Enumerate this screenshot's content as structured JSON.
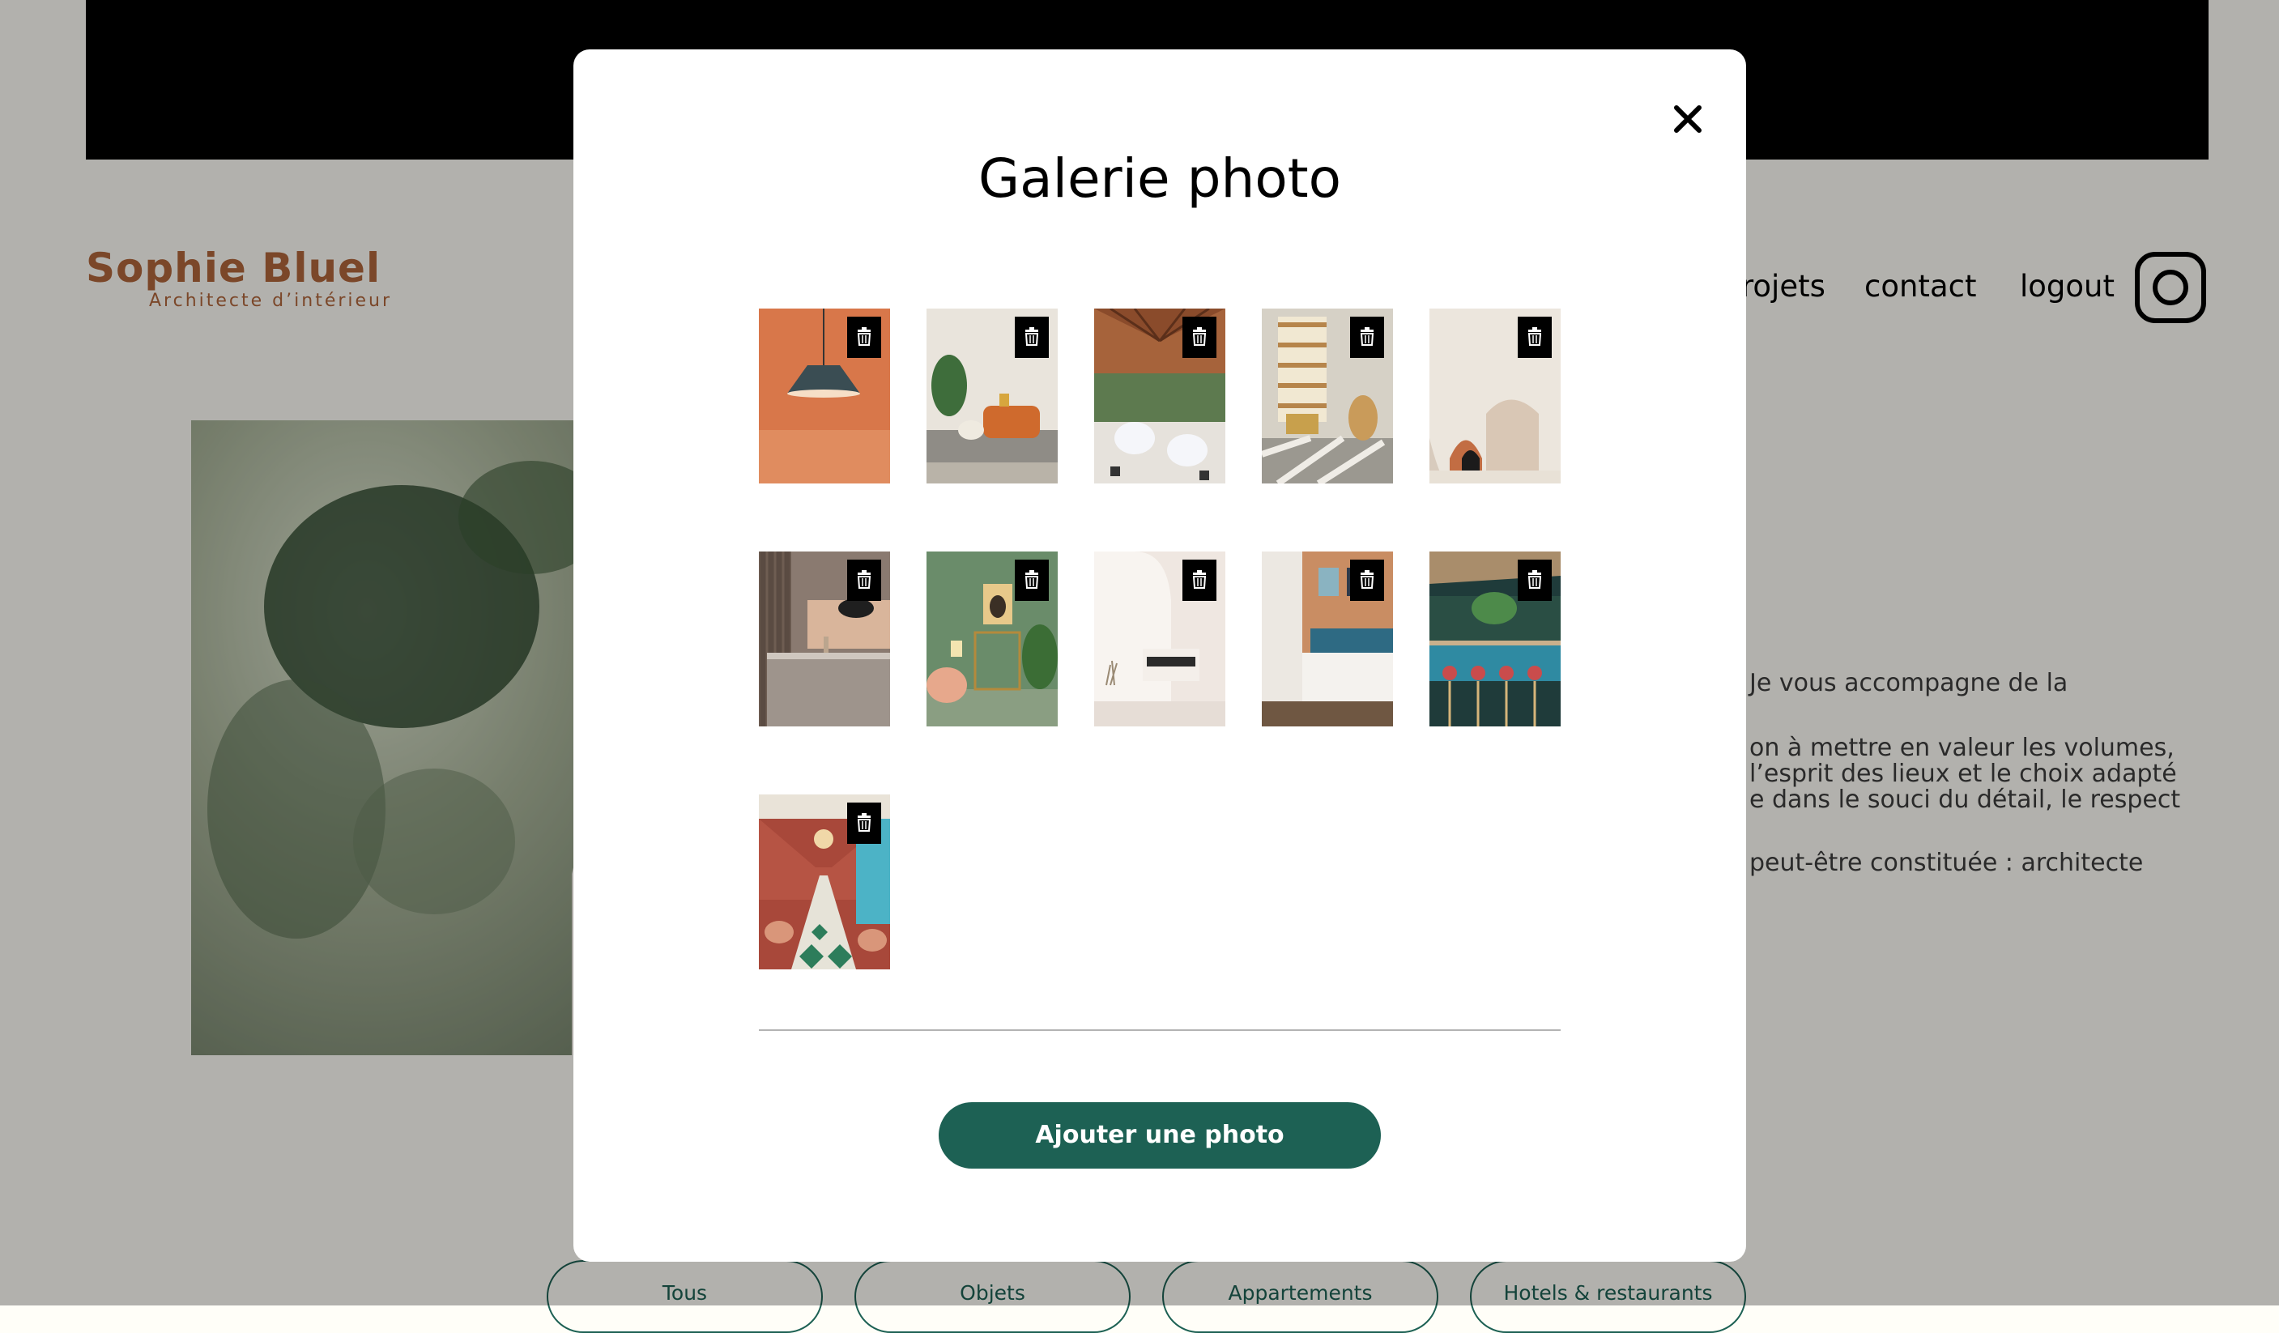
{
  "page": {
    "logo": {
      "title": "Sophie Bluel",
      "subtitle": "Architecte d’intérieur"
    },
    "nav": {
      "projects": "rojets",
      "contact": "contact",
      "logout": "logout",
      "instagram_icon": "instagram-icon"
    },
    "about_lines": [
      "Je vous accompagne de la",
      "on à mettre en valeur les volumes,",
      "l’esprit des lieux et le choix adapté",
      "e dans le souci du détail, le respect",
      "peut-être constituée : architecte"
    ],
    "filters": [
      "Tous",
      "Objets",
      "Appartements",
      "Hotels & restaurants"
    ]
  },
  "modal": {
    "title": "Galerie photo",
    "close_icon": "close-icon",
    "delete_icon": "trash-icon",
    "photos": [
      {
        "name": "photo-pendant-lamp"
      },
      {
        "name": "photo-living-room"
      },
      {
        "name": "photo-restaurant"
      },
      {
        "name": "photo-sunroom"
      },
      {
        "name": "photo-arches"
      },
      {
        "name": "photo-kitchen"
      },
      {
        "name": "photo-green-room"
      },
      {
        "name": "photo-white-room"
      },
      {
        "name": "photo-bedroom"
      },
      {
        "name": "photo-bar"
      },
      {
        "name": "photo-dining-hall"
      }
    ],
    "add_button": "Ajouter une photo"
  },
  "colors": {
    "accent": "#1d6154",
    "brand": "#b1663c",
    "overlay": "rgba(0,0,0,0.3)"
  }
}
